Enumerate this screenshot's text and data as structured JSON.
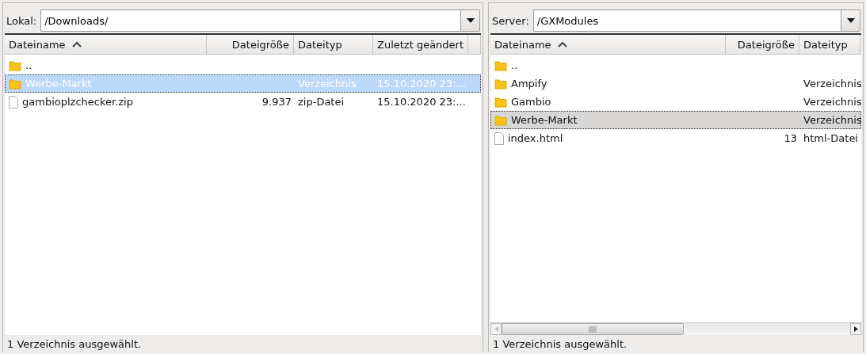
{
  "panels": [
    {
      "label": "Lokal:",
      "path": "/Downloads/",
      "active": true,
      "columns": [
        {
          "label": "Dateiname",
          "kind": "name",
          "sorted": true
        },
        {
          "label": "Dateigröße",
          "kind": "size",
          "sorted": false
        },
        {
          "label": "Dateityp",
          "kind": "type",
          "sorted": false
        },
        {
          "label": "Zuletzt geändert",
          "kind": "modified",
          "sorted": false
        }
      ],
      "rows": [
        {
          "kind": "folder",
          "selected": false,
          "cells": [
            ".."
          ]
        },
        {
          "kind": "folder",
          "selected": true,
          "cells": [
            "Werbe-Markt",
            "",
            "Verzeichnis",
            "15.10.2020 23:..."
          ]
        },
        {
          "kind": "file",
          "selected": false,
          "cells": [
            "gambioplzchecker.zip",
            "9.937",
            "zip-Datei",
            "15.10.2020 23:..."
          ]
        }
      ],
      "status": "1 Verzeichnis ausgewählt."
    },
    {
      "label": "Server:",
      "path": "/GXModules",
      "active": false,
      "hscroll": true,
      "columns": [
        {
          "label": "Dateiname",
          "kind": "name",
          "sorted": true
        },
        {
          "label": "Dateigröße",
          "kind": "size",
          "sorted": false
        },
        {
          "label": "Dateityp",
          "kind": "type",
          "sorted": false
        }
      ],
      "rows": [
        {
          "kind": "folder",
          "selected": false,
          "cells": [
            ".."
          ]
        },
        {
          "kind": "folder",
          "selected": false,
          "cells": [
            "Ampify",
            "",
            "Verzeichnis"
          ]
        },
        {
          "kind": "folder",
          "selected": false,
          "cells": [
            "Gambio",
            "",
            "Verzeichnis"
          ]
        },
        {
          "kind": "folder",
          "selected": true,
          "cells": [
            "Werbe-Markt",
            "",
            "Verzeichnis"
          ]
        },
        {
          "kind": "file",
          "selected": false,
          "cells": [
            "index.html",
            "13",
            "html-Datei"
          ]
        }
      ],
      "status": "1 Verzeichnis ausgewählt."
    }
  ]
}
